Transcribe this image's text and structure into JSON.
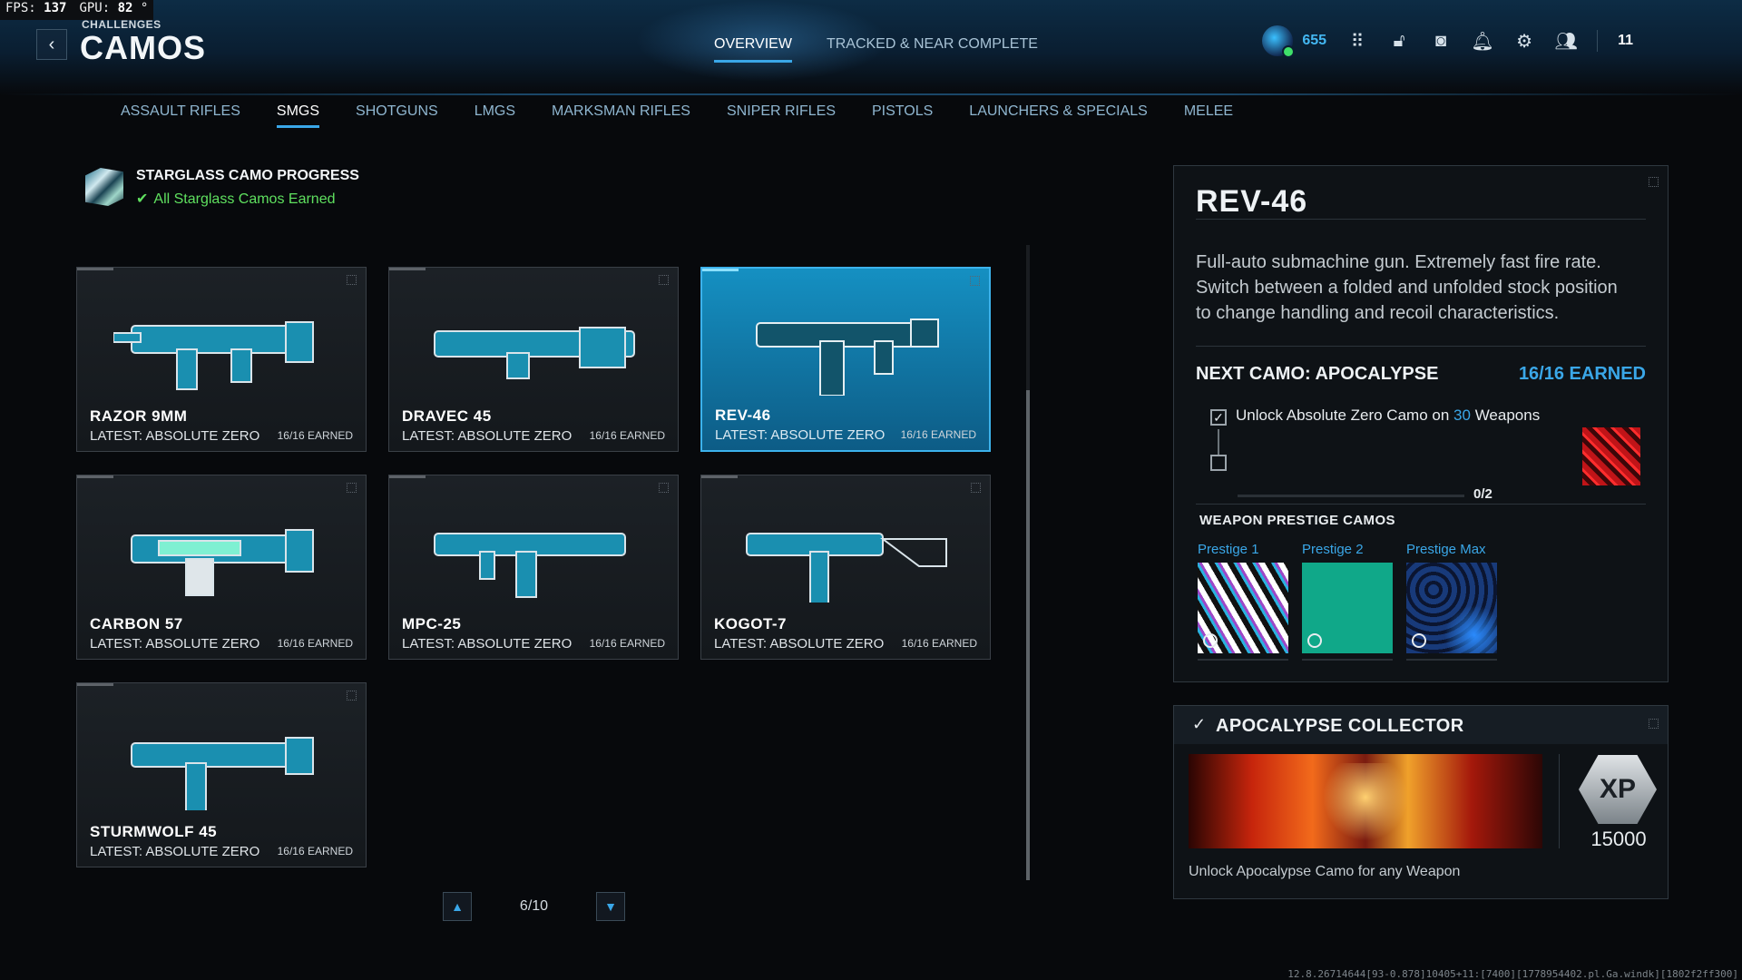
{
  "hud": {
    "fps_label": "FPS:",
    "fps_value": "137",
    "gpu_label": "GPU:",
    "gpu_value": "82"
  },
  "header": {
    "breadcrumb": "CHALLENGES",
    "title": "CAMOS"
  },
  "top_tabs": [
    "OVERVIEW",
    "TRACKED & NEAR COMPLETE"
  ],
  "player": {
    "level": "655",
    "count": "11"
  },
  "category_tabs": [
    "ASSAULT RIFLES",
    "SMGS",
    "SHOTGUNS",
    "LMGS",
    "MARKSMAN RIFLES",
    "SNIPER RIFLES",
    "PISTOLS",
    "LAUNCHERS & SPECIALS",
    "MELEE"
  ],
  "starglass": {
    "title": "STARGLASS CAMO PROGRESS",
    "status": "All Starglass Camos Earned"
  },
  "weapons": [
    {
      "name": "RAZOR 9MM",
      "latest": "LATEST: ABSOLUTE ZERO",
      "earned": "16/16 EARNED"
    },
    {
      "name": "DRAVEC 45",
      "latest": "LATEST: ABSOLUTE ZERO",
      "earned": "16/16 EARNED"
    },
    {
      "name": "REV-46",
      "latest": "LATEST: ABSOLUTE ZERO",
      "earned": "16/16 EARNED"
    },
    {
      "name": "CARBON 57",
      "latest": "LATEST: ABSOLUTE ZERO",
      "earned": "16/16 EARNED"
    },
    {
      "name": "MPC-25",
      "latest": "LATEST: ABSOLUTE ZERO",
      "earned": "16/16 EARNED"
    },
    {
      "name": "KOGOT-7",
      "latest": "LATEST: ABSOLUTE ZERO",
      "earned": "16/16 EARNED"
    },
    {
      "name": "STURMWOLF 45",
      "latest": "LATEST: ABSOLUTE ZERO",
      "earned": "16/16 EARNED"
    }
  ],
  "pager": {
    "label": "6/10"
  },
  "detail": {
    "title": "REV-46",
    "description": "Full-auto submachine gun. Extremely fast fire rate. Switch between a folded and unfolded stock position to change handling and recoil characteristics.",
    "next_camo": "NEXT CAMO: APOCALYPSE",
    "earned": "16/16 EARNED",
    "task_prefix": "Unlock Absolute Zero Camo on",
    "task_count": "30",
    "task_suffix": "Weapons",
    "progress": "0/2",
    "prestige_header": "WEAPON PRESTIGE CAMOS",
    "prestige": [
      "Prestige 1",
      "Prestige 2",
      "Prestige Max"
    ]
  },
  "collector": {
    "title": "APOCALYPSE COLLECTOR",
    "xp_badge": "XP",
    "xp_value": "15000",
    "description": "Unlock Apocalypse Camo for any Weapon"
  },
  "build_info": "12.8.26714644[93-0.878]10405+11:[7400][1778954402.pl.Ga.windk][1802f2ff300]"
}
